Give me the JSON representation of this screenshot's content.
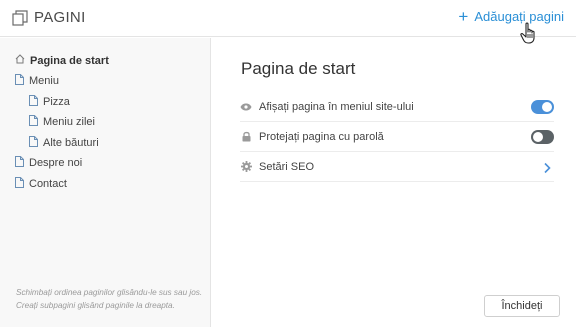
{
  "header": {
    "title": "PAGINI",
    "add_pages_label": "Adăugați pagini"
  },
  "sidebar": {
    "pages": [
      {
        "label": "Pagina de start",
        "icon": "home-icon",
        "level": 0,
        "active": true
      },
      {
        "label": "Meniu",
        "icon": "page-icon",
        "level": 0,
        "active": false
      },
      {
        "label": "Pizza",
        "icon": "page-icon",
        "level": 1,
        "active": false
      },
      {
        "label": "Meniu zilei",
        "icon": "page-icon",
        "level": 1,
        "active": false
      },
      {
        "label": "Alte băuturi",
        "icon": "page-icon",
        "level": 1,
        "active": false
      },
      {
        "label": "Despre noi",
        "icon": "page-icon",
        "level": 0,
        "active": false
      },
      {
        "label": "Contact",
        "icon": "page-icon",
        "level": 0,
        "active": false
      }
    ],
    "hint": "Schimbați ordinea paginilor glisându-le sus sau jos. Creați subpagini glisând paginile la dreapta."
  },
  "main": {
    "title": "Pagina de start",
    "settings": [
      {
        "label": "Afișați pagina în meniul site-ului",
        "icon": "eye-icon",
        "control": "toggle",
        "on": true
      },
      {
        "label": "Protejați pagina cu parolă",
        "icon": "lock-icon",
        "control": "toggle",
        "on": false
      },
      {
        "label": "Setări SEO",
        "icon": "gear-icon",
        "control": "chevron"
      }
    ],
    "close_label": "Închideți"
  },
  "colors": {
    "accent": "#2a8fd6",
    "toggle_on": "#4a90d9",
    "toggle_off": "#5b6266",
    "sidebar_bg": "#f8f8f8"
  }
}
